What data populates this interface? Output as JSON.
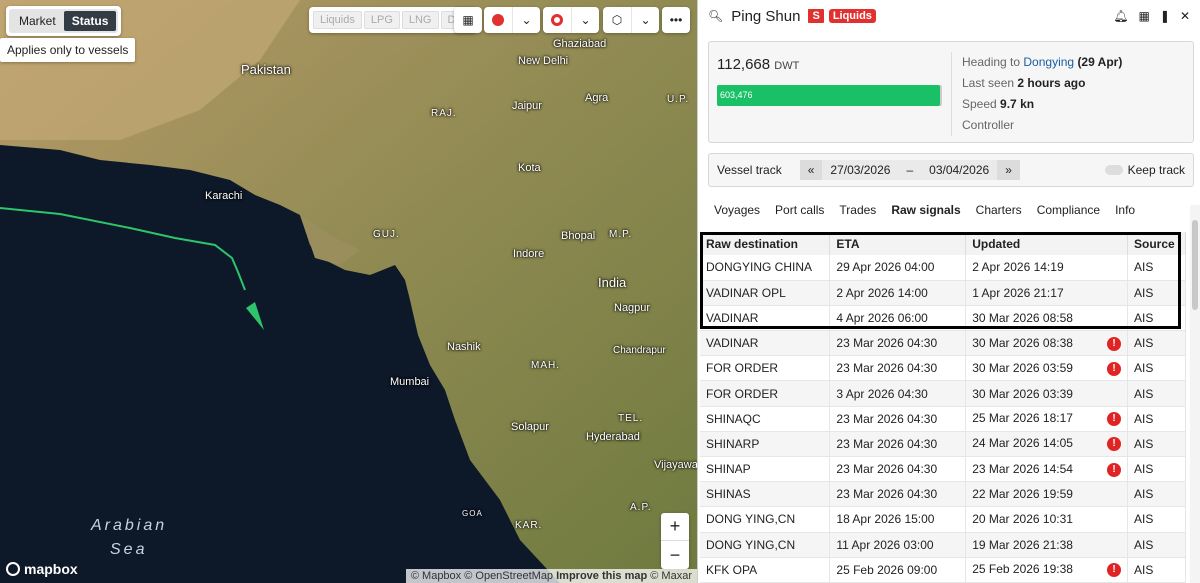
{
  "map": {
    "market_label": "Market",
    "status_label": "Status",
    "tooltip": "Applies only to vessels",
    "type_filters": [
      "Liquids",
      "LPG",
      "LNG",
      "Dry"
    ],
    "zoom_in": "+",
    "zoom_out": "−",
    "logo": "mapbox",
    "attribution": {
      "mapbox": "© Mapbox",
      "osm": "© OpenStreetMap",
      "improve": "Improve this map",
      "maxar": "© Maxar"
    },
    "places": [
      {
        "name": "Pakistan",
        "cls": "big"
      },
      {
        "name": "Ghaziabad",
        "cls": ""
      },
      {
        "name": "New Delhi",
        "cls": ""
      },
      {
        "name": "Jaipur",
        "cls": ""
      },
      {
        "name": "Agra",
        "cls": ""
      },
      {
        "name": "U.P.",
        "cls": "state"
      },
      {
        "name": "RAJ.",
        "cls": "state"
      },
      {
        "name": "Karachi",
        "cls": ""
      },
      {
        "name": "Kota",
        "cls": ""
      },
      {
        "name": "GUJ.",
        "cls": "state"
      },
      {
        "name": "Bhopal",
        "cls": ""
      },
      {
        "name": "M.P.",
        "cls": "state"
      },
      {
        "name": "Indore",
        "cls": ""
      },
      {
        "name": "India",
        "cls": "big"
      },
      {
        "name": "Nagpur",
        "cls": ""
      },
      {
        "name": "Nashik",
        "cls": ""
      },
      {
        "name": "MAH.",
        "cls": "state"
      },
      {
        "name": "Chandrapur",
        "cls": ""
      },
      {
        "name": "Mumbai",
        "cls": ""
      },
      {
        "name": "TEL.",
        "cls": "state"
      },
      {
        "name": "Solapur",
        "cls": ""
      },
      {
        "name": "Hyderabad",
        "cls": ""
      },
      {
        "name": "Vijayawa",
        "cls": ""
      },
      {
        "name": "GOA",
        "cls": "state"
      },
      {
        "name": "A.P.",
        "cls": "state"
      },
      {
        "name": "KAR.",
        "cls": "state"
      },
      {
        "name": "Arabian",
        "cls": "sea"
      },
      {
        "name": "Sea",
        "cls": "sea"
      }
    ]
  },
  "vessel": {
    "name": "Ping Shun",
    "flag_badge": "S",
    "segment_badge": "Liquids",
    "dwt": "112,668",
    "dwt_unit": "DWT",
    "cargo_value": "603,476",
    "cargo_fraction": 0.99,
    "heading_label": "Heading to",
    "heading_dest": "Dongying",
    "heading_date": "(29 Apr)",
    "last_seen_label": "Last seen",
    "last_seen_value": "2 hours ago",
    "speed_label": "Speed",
    "speed_value": "9.7 kn",
    "controller_label": "Controller"
  },
  "track": {
    "label": "Vessel track",
    "from": "27/03/2026",
    "sep": "–",
    "to": "03/04/2026",
    "prev": "«",
    "next": "»",
    "keep_label": "Keep track"
  },
  "tabs": [
    "Voyages",
    "Port calls",
    "Trades",
    "Raw signals",
    "Charters",
    "Compliance",
    "Info"
  ],
  "active_tab": "Raw signals",
  "table": {
    "headers": [
      "Raw destination",
      "ETA",
      "Updated",
      "Source"
    ],
    "rows": [
      {
        "dest": "DONGYING CHINA",
        "eta": "29 Apr 2026 04:00",
        "updated": "2 Apr 2026 14:19",
        "warn": false,
        "source": "AIS"
      },
      {
        "dest": "VADINAR OPL",
        "eta": "2 Apr 2026 14:00",
        "updated": "1 Apr 2026 21:17",
        "warn": false,
        "source": "AIS"
      },
      {
        "dest": "VADINAR",
        "eta": "4 Apr 2026 06:00",
        "updated": "30 Mar 2026 08:58",
        "warn": false,
        "source": "AIS"
      },
      {
        "dest": "VADINAR",
        "eta": "23 Mar 2026 04:30",
        "updated": "30 Mar 2026 08:38",
        "warn": true,
        "source": "AIS"
      },
      {
        "dest": "FOR ORDER",
        "eta": "23 Mar 2026 04:30",
        "updated": "30 Mar 2026 03:59",
        "warn": true,
        "source": "AIS"
      },
      {
        "dest": "FOR ORDER",
        "eta": "3 Apr 2026 04:30",
        "updated": "30 Mar 2026 03:39",
        "warn": false,
        "source": "AIS"
      },
      {
        "dest": "SHINAQC",
        "eta": "23 Mar 2026 04:30",
        "updated": "25 Mar 2026 18:17",
        "warn": true,
        "source": "AIS"
      },
      {
        "dest": "SHINARP",
        "eta": "23 Mar 2026 04:30",
        "updated": "24 Mar 2026 14:05",
        "warn": true,
        "source": "AIS"
      },
      {
        "dest": "SHINAP",
        "eta": "23 Mar 2026 04:30",
        "updated": "23 Mar 2026 14:54",
        "warn": true,
        "source": "AIS"
      },
      {
        "dest": "SHINAS",
        "eta": "23 Mar 2026 04:30",
        "updated": "22 Mar 2026 19:59",
        "warn": false,
        "source": "AIS"
      },
      {
        "dest": "DONG YING,CN",
        "eta": "18 Apr 2026 15:00",
        "updated": "20 Mar 2026 10:31",
        "warn": false,
        "source": "AIS"
      },
      {
        "dest": "DONG YING,CN",
        "eta": "11 Apr 2026 03:00",
        "updated": "19 Mar 2026 21:38",
        "warn": false,
        "source": "AIS"
      },
      {
        "dest": "KFK OPA",
        "eta": "25 Feb 2026 09:00",
        "updated": "25 Feb 2026 19:38",
        "warn": true,
        "source": "AIS"
      }
    ]
  },
  "colors": {
    "accent_red": "#e0312f",
    "track_green": "#2ec46b",
    "cargo_green": "#19c065",
    "link_blue": "#1a5fa0"
  }
}
